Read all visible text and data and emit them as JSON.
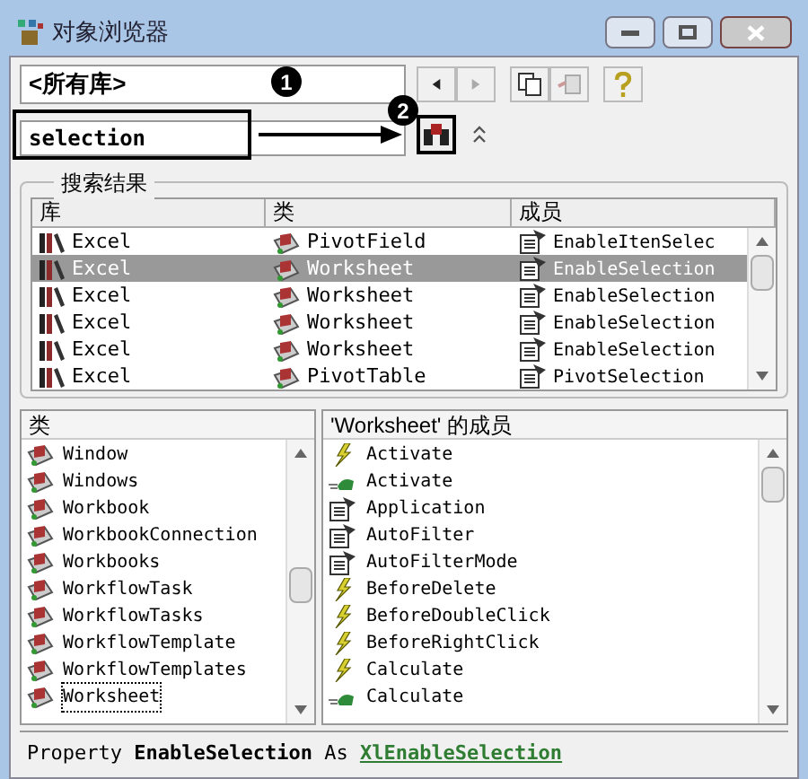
{
  "window": {
    "title": "对象浏览器"
  },
  "library_dropdown": {
    "value": "<所有库>"
  },
  "search_field": {
    "value": "selection"
  },
  "callouts": [
    "1",
    "2"
  ],
  "search_results": {
    "title": "搜索结果",
    "columns": [
      "库",
      "类",
      "成员"
    ],
    "rows": [
      {
        "library": "Excel",
        "class": "PivotField",
        "member": "EnableItenSelec",
        "selected": false
      },
      {
        "library": "Excel",
        "class": "Worksheet",
        "member": "EnableSelection",
        "selected": true
      },
      {
        "library": "Excel",
        "class": "Worksheet",
        "member": "EnableSelection",
        "selected": false
      },
      {
        "library": "Excel",
        "class": "Worksheet",
        "member": "EnableSelection",
        "selected": false
      },
      {
        "library": "Excel",
        "class": "Worksheet",
        "member": "EnableSelection",
        "selected": false
      },
      {
        "library": "Excel",
        "class": "PivotTable",
        "member": "PivotSelection",
        "selected": false
      }
    ]
  },
  "classes": {
    "title": "类",
    "items": [
      {
        "label": "Window",
        "selected": false
      },
      {
        "label": "Windows",
        "selected": false
      },
      {
        "label": "Workbook",
        "selected": false
      },
      {
        "label": "WorkbookConnection",
        "selected": false
      },
      {
        "label": "Workbooks",
        "selected": false
      },
      {
        "label": "WorkflowTask",
        "selected": false
      },
      {
        "label": "WorkflowTasks",
        "selected": false
      },
      {
        "label": "WorkflowTemplate",
        "selected": false
      },
      {
        "label": "WorkflowTemplates",
        "selected": false
      },
      {
        "label": "Worksheet",
        "selected": true
      }
    ]
  },
  "members": {
    "title": "'Worksheet' 的成员",
    "items": [
      {
        "label": "Activate",
        "kind": "event"
      },
      {
        "label": "Activate",
        "kind": "method"
      },
      {
        "label": "Application",
        "kind": "property"
      },
      {
        "label": "AutoFilter",
        "kind": "property"
      },
      {
        "label": "AutoFilterMode",
        "kind": "property"
      },
      {
        "label": "BeforeDelete",
        "kind": "event"
      },
      {
        "label": "BeforeDoubleClick",
        "kind": "event"
      },
      {
        "label": "BeforeRightClick",
        "kind": "event"
      },
      {
        "label": "Calculate",
        "kind": "event"
      },
      {
        "label": "Calculate",
        "kind": "method"
      }
    ]
  },
  "details": {
    "prefix": "Property",
    "name": "EnableSelection",
    "as": "As",
    "type_link": "XlEnableSelection"
  }
}
